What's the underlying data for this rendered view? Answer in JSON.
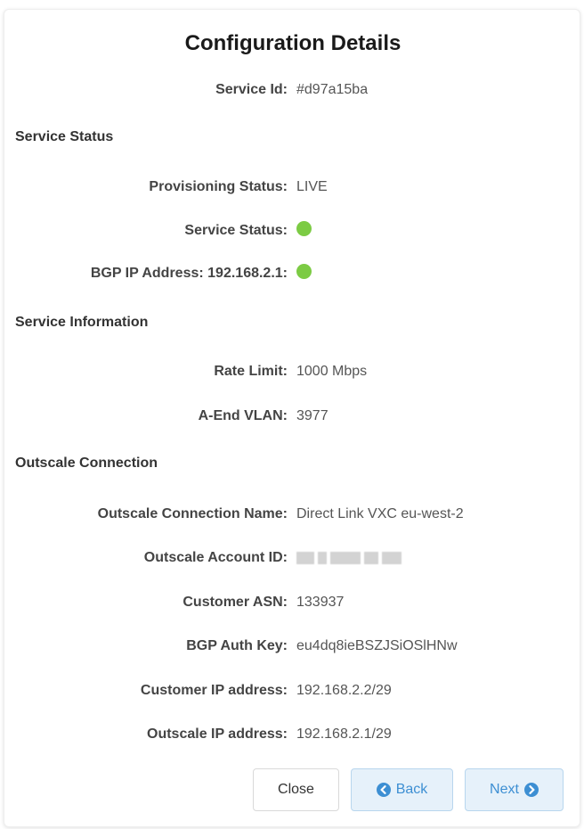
{
  "title": "Configuration Details",
  "service_id": {
    "label": "Service Id:",
    "value": "#d97a15ba"
  },
  "sections": {
    "status": "Service Status",
    "information": "Service Information",
    "connection": "Outscale Connection"
  },
  "status": {
    "provisioning_label": "Provisioning Status:",
    "provisioning_value": "LIVE",
    "service_status_label": "Service Status:",
    "bgp_label": "BGP IP Address: 192.168.2.1:"
  },
  "information": {
    "rate_limit_label": "Rate Limit:",
    "rate_limit_value": "1000 Mbps",
    "vlan_label": "A-End VLAN:",
    "vlan_value": "3977"
  },
  "connection": {
    "name_label": "Outscale Connection Name:",
    "name_value": "Direct Link VXC eu-west-2",
    "account_label": "Outscale Account ID:",
    "asn_label": "Customer ASN:",
    "asn_value": "133937",
    "auth_key_label": "BGP Auth Key:",
    "auth_key_value": "eu4dq8ieBSZJSiOSlHNw",
    "customer_ip_label": "Customer IP address:",
    "customer_ip_value": "192.168.2.2/29",
    "outscale_ip_label": "Outscale IP address:",
    "outscale_ip_value": "192.168.2.1/29"
  },
  "buttons": {
    "close": "Close",
    "back": "Back",
    "next": "Next"
  },
  "colors": {
    "status_ok": "#7ccb44",
    "accent": "#3d8fd3"
  },
  "icons": {
    "back": "circle-arrow-left-icon",
    "next": "circle-arrow-right-icon"
  }
}
